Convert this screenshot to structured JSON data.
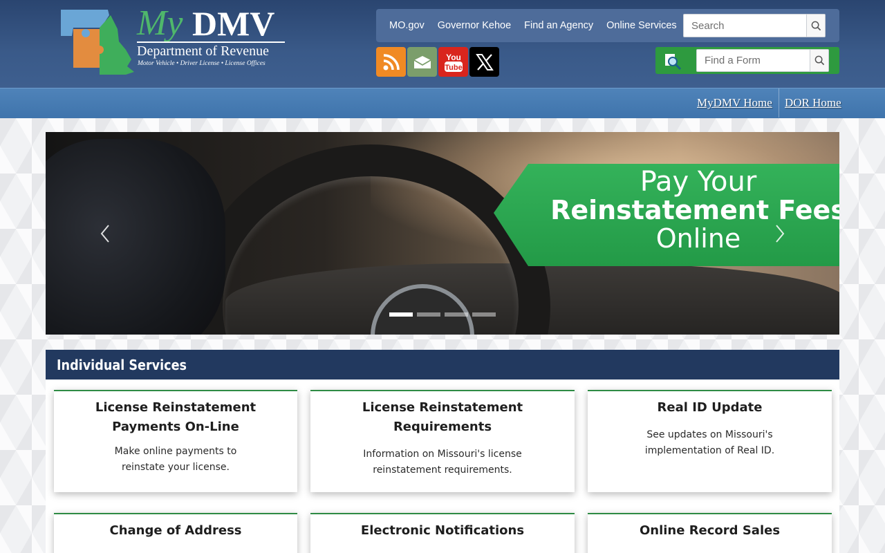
{
  "header": {
    "logo": {
      "my": "My",
      "dmv": "DMV",
      "department": "Department of Revenue",
      "tagline": "Motor Vehicle  •  Driver License  •  License Offices"
    },
    "top_links": [
      "MO.gov",
      "Governor Kehoe",
      "Find an Agency",
      "Online Services"
    ],
    "search": {
      "placeholder": "Search"
    },
    "social": [
      "rss-icon",
      "mail-icon",
      "youtube-icon",
      "x-icon"
    ],
    "find_form": {
      "placeholder": "Find a Form"
    }
  },
  "nav": {
    "home": "MyDMV Home",
    "dor": "DOR Home"
  },
  "hero": {
    "line1": "Pay Your",
    "line2": "Reinstatement Fees",
    "line3": "Online",
    "slide_count": 4,
    "active_slide": 1
  },
  "services": {
    "heading": "Individual Services",
    "cards": [
      {
        "title": "License Reinstatement Payments On-Line",
        "desc": "Make online payments to reinstate your license."
      },
      {
        "title": "License Reinstatement Requirements",
        "desc": "Information on Missouri's license reinstatement requirements."
      },
      {
        "title": "Real ID Update",
        "desc": "See updates on Missouri's implementation of Real ID."
      },
      {
        "title": "Change of Address",
        "desc": ""
      },
      {
        "title": "Electronic Notifications",
        "desc": ""
      },
      {
        "title": "Online Record Sales",
        "desc": ""
      }
    ]
  },
  "colors": {
    "header_dark": "#2a4570",
    "nav_blue": "#4f83b9",
    "accent_green": "#2e9a3f",
    "services_head": "#22395f"
  }
}
